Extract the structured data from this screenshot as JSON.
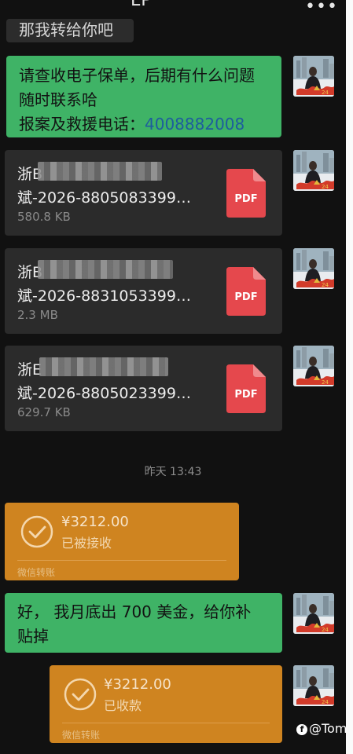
{
  "header": {
    "title": "LP",
    "more_icon": "more-horizontal-icon"
  },
  "messages": {
    "prev_text": "那我转给你吧",
    "policy": {
      "line1": "请查收电子保单，后期有什么问题",
      "line2": "随时联系哈",
      "line3_prefix": "报案及救援电话：",
      "phone": "4008882008"
    },
    "files": [
      {
        "name_top": "浙B",
        "name_bottom": "斌-2026-8805083399…",
        "size": "580.8 KB",
        "icon": "pdf-icon",
        "label": "PDF"
      },
      {
        "name_top": "浙B",
        "name_bottom": "斌-2026-8831053399…",
        "size": "2.3 MB",
        "icon": "pdf-icon",
        "label": "PDF"
      },
      {
        "name_top": "浙E",
        "name_bottom": "斌-2026-8805023399…",
        "size": "629.7 KB",
        "icon": "pdf-icon",
        "label": "PDF"
      }
    ],
    "timestamp": "昨天 13:43",
    "transfer_received": {
      "amount": "¥3212.00",
      "status": "已被接收",
      "label": "微信转账"
    },
    "reply": {
      "line1": "好， 我月底出 700 美金，给你补",
      "line2": "贴掉"
    },
    "transfer_collected": {
      "amount": "¥3212.00",
      "status": "已收款",
      "label": "微信转账"
    }
  },
  "watermark": {
    "text": "@Tom"
  },
  "colors": {
    "bg": "#111111",
    "green": "#3fb366",
    "orange": "#cf8420",
    "pdf_red": "#e5484d",
    "link": "#1d5d9e"
  }
}
